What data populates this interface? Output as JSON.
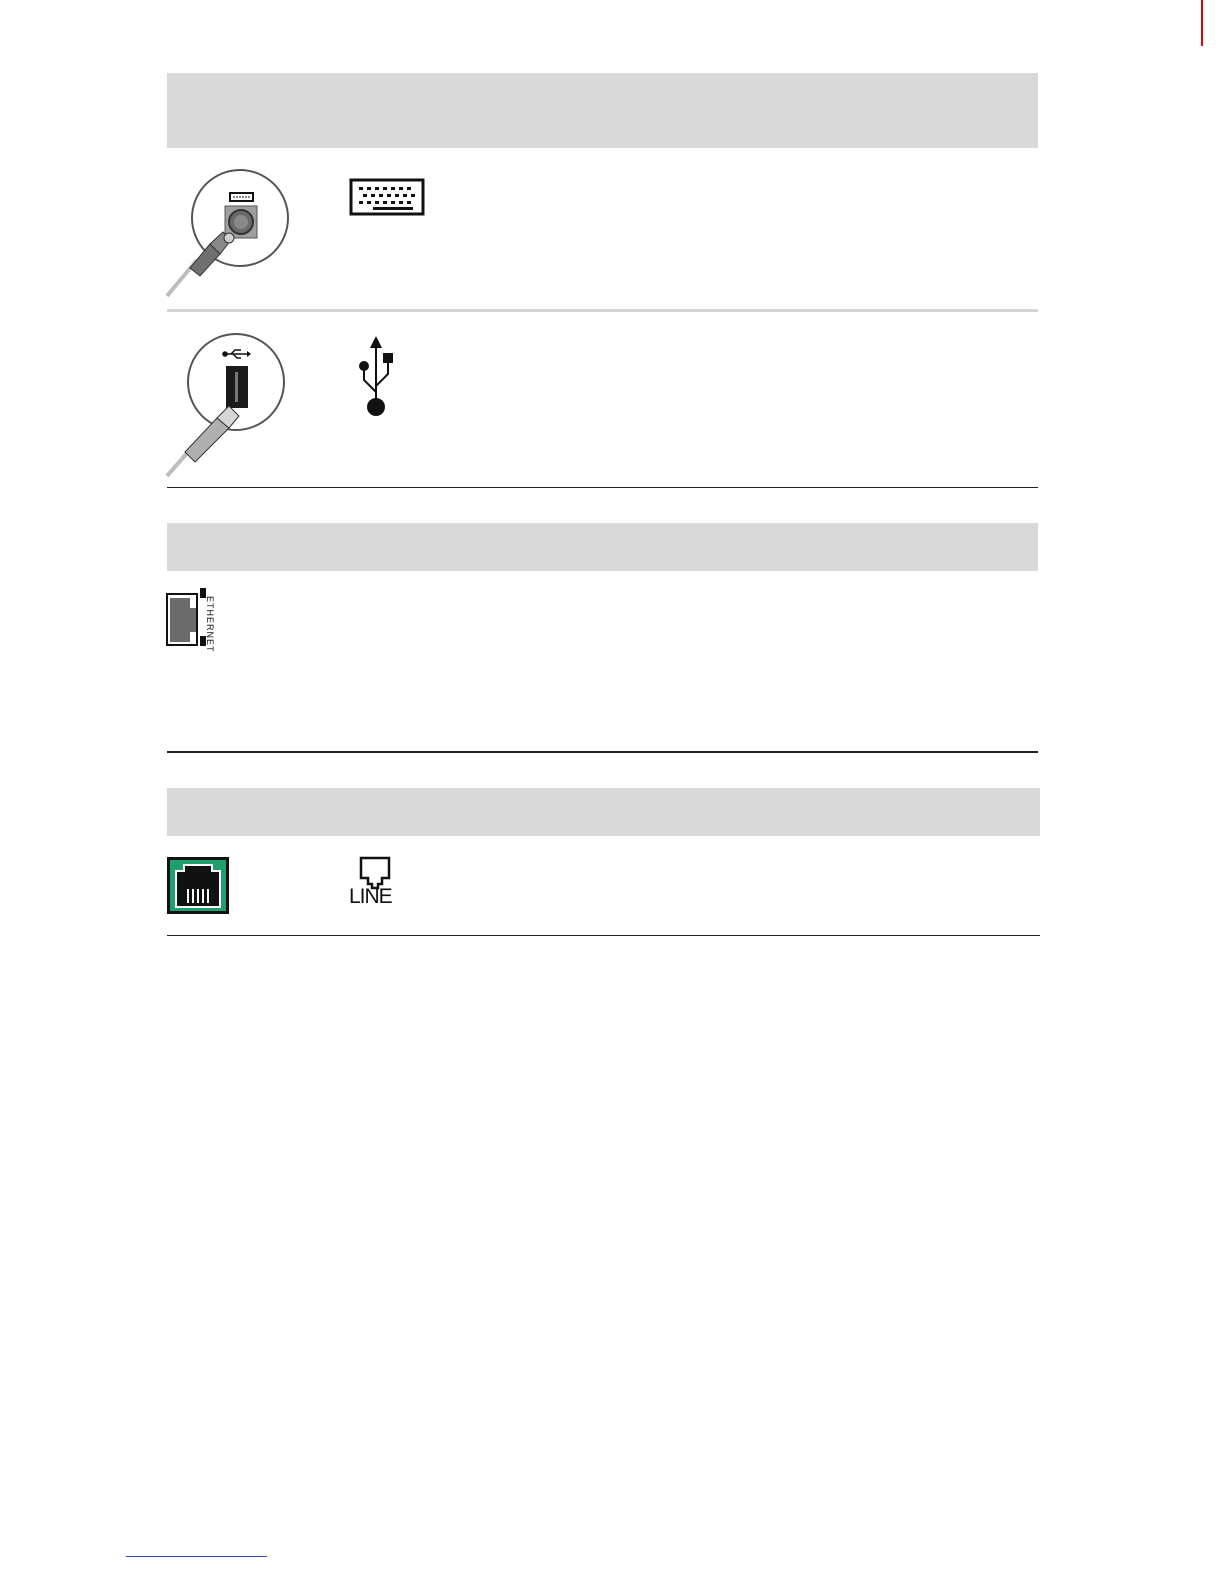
{
  "connectors": {
    "ethernet_label": "ETHERNET",
    "line_label": "LINE"
  },
  "icons": {
    "ps2_plug": "ps2-keyboard-connector-icon",
    "keyboard": "keyboard-icon",
    "usb_plug": "usb-connector-icon",
    "usb_symbol": "usb-symbol-icon",
    "ethernet_port": "ethernet-port-icon",
    "modem_port": "modem-port-icon",
    "line_jack": "phone-line-icon"
  },
  "colors": {
    "header_band": "#d9d9d9",
    "modem_green": "#1f9e6e",
    "accent_red": "#e60000"
  }
}
